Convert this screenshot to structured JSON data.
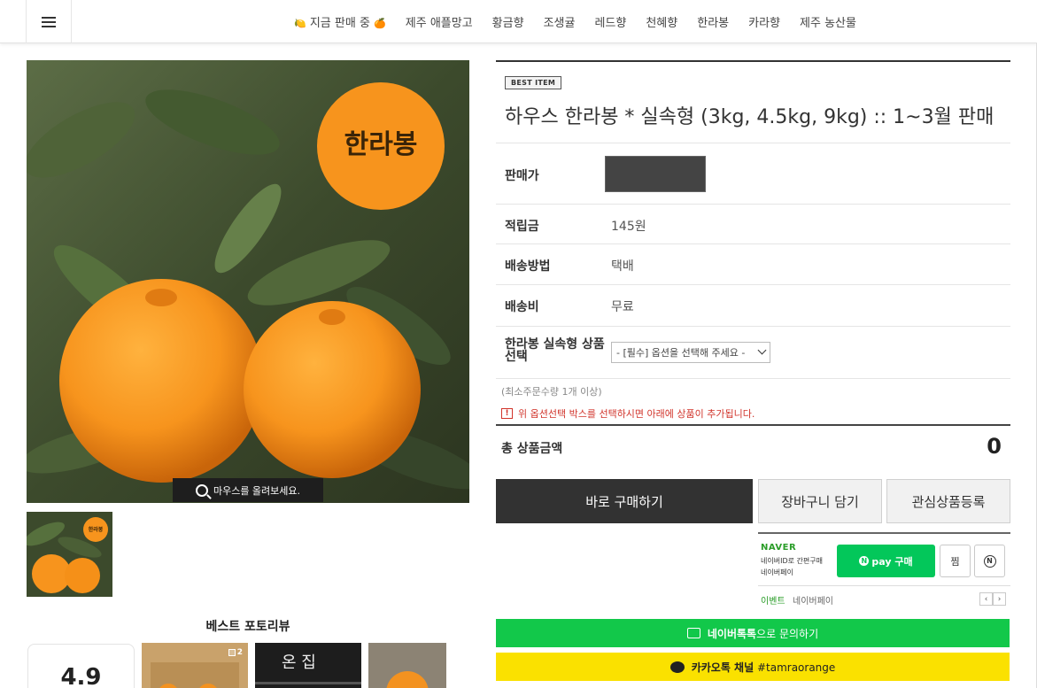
{
  "nav": {
    "items": [
      {
        "label": "지금 판매 중",
        "prefix_icon": "🍋",
        "suffix_icon": "🍊"
      },
      {
        "label": "제주 애플망고"
      },
      {
        "label": "황금향"
      },
      {
        "label": "조생귤"
      },
      {
        "label": "레드향"
      },
      {
        "label": "천혜향"
      },
      {
        "label": "한라봉"
      },
      {
        "label": "카라향"
      },
      {
        "label": "제주 농산물"
      }
    ]
  },
  "gallery": {
    "main_label": "한라봉",
    "hover_hint": "마우스를 올려보세요.",
    "thumb_label": "한라봉"
  },
  "product": {
    "badge": "BEST ITEM",
    "title": "하우스 한라봉 * 실속형 (3kg, 4.5kg, 9kg) :: 1~3월 판매",
    "rows": {
      "price_label": "판매가",
      "points_label": "적립금",
      "points_value": "145원",
      "shipping_method_label": "배송방법",
      "shipping_method_value": "택배",
      "shipping_fee_label": "배송비",
      "shipping_fee_value": "무료",
      "option_label": "한라봉 실속형 상품선택",
      "option_placeholder": "- [필수] 옵션을 선택해 주세요 -"
    },
    "min_qty": "(최소주문수량 1개 이상)",
    "warning": "위 옵션선택 박스를 선택하시면 아래에 상품이 추가됩니다.",
    "total_label": "총 상품금액",
    "total_value": "0"
  },
  "actions": {
    "buy": "바로 구매하기",
    "cart": "장바구니 담기",
    "wishlist": "관심상품등록"
  },
  "npay": {
    "brand": "NAVER",
    "desc_line1": "네이버ID로 간편구매",
    "desc_line2": "네이버페이",
    "pay_button": "pay 구매",
    "zzim": "찜",
    "event_label": "이벤트",
    "event_text": "네이버페이"
  },
  "talk": {
    "naver_bold": "네이버톡톡",
    "naver_rest": "으로 문의하기",
    "kakao_bold": "카카오톡 채널",
    "kakao_rest": "#tamraorange"
  },
  "reviews": {
    "title": "베스트 포토리뷰",
    "rating": "4.9",
    "photo_count": "2",
    "photo_text": "온 집"
  },
  "colors": {
    "orange": "#f7941d",
    "leaf": "#3b4a2e",
    "naver_green": "#03c75a",
    "kakao_yellow": "#fae100",
    "warning_red": "#d1342b"
  }
}
